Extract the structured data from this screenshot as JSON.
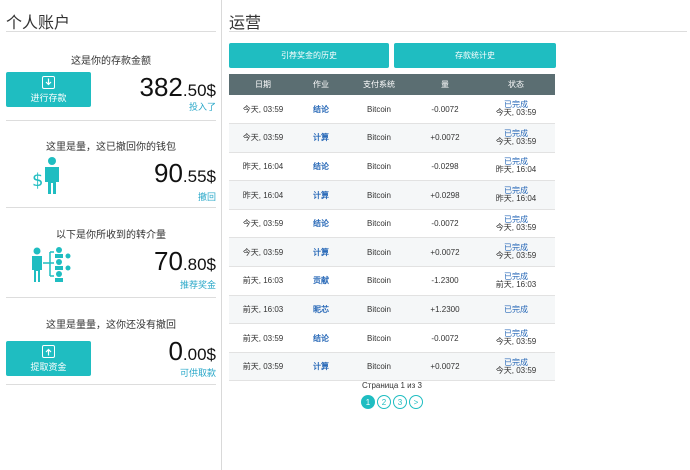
{
  "left": {
    "title": "个人账户",
    "blocks": [
      {
        "heading": "这是你的存款金额",
        "big": "382",
        "small": ".50$",
        "link": "投入了",
        "button": "进行存款"
      },
      {
        "heading": "这里是量，这已撤回你的钱包",
        "big": "90",
        "small": ".55$",
        "link": "撤回"
      },
      {
        "heading": "以下是你所收到的转介量",
        "big": "70",
        "small": ".80$",
        "link": "推荐奖金"
      },
      {
        "heading": "这里是量量，这你还没有撤回",
        "big": "0",
        "small": ".00$",
        "link": "可供取款",
        "button": "提取资金"
      }
    ]
  },
  "right": {
    "title": "运营",
    "tab1": "引荐奖金的历史",
    "tab2": "存款统计史",
    "columns": [
      "日期",
      "作业",
      "支付系统",
      "量",
      "状态"
    ],
    "rows": [
      {
        "date": "今天, 03:59",
        "op": "结论",
        "system": "Bitcoin",
        "amount": "-0.0072",
        "sign": "neg",
        "status": "已完成",
        "status_sub": "今天, 03:59"
      },
      {
        "date": "今天, 03:59",
        "op": "计算",
        "system": "Bitcoin",
        "amount": "+0.0072",
        "sign": "pos",
        "status": "已完成",
        "status_sub": "今天, 03:59"
      },
      {
        "date": "昨天, 16:04",
        "op": "结论",
        "system": "Bitcoin",
        "amount": "-0.0298",
        "sign": "neg",
        "status": "已完成",
        "status_sub": "昨天, 16:04"
      },
      {
        "date": "昨天, 16:04",
        "op": "计算",
        "system": "Bitcoin",
        "amount": "+0.0298",
        "sign": "pos",
        "status": "已完成",
        "status_sub": "昨天, 16:04"
      },
      {
        "date": "今天, 03:59",
        "op": "结论",
        "system": "Bitcoin",
        "amount": "-0.0072",
        "sign": "neg",
        "status": "已完成",
        "status_sub": "今天, 03:59"
      },
      {
        "date": "今天, 03:59",
        "op": "计算",
        "system": "Bitcoin",
        "amount": "+0.0072",
        "sign": "pos",
        "status": "已完成",
        "status_sub": "今天, 03:59"
      },
      {
        "date": "前天, 16:03",
        "op": "贡献",
        "system": "Bitcoin",
        "amount": "-1.2300",
        "sign": "neg",
        "status": "已完成",
        "status_sub": "前天, 16:03"
      },
      {
        "date": "前天, 16:03",
        "op": "昵芯",
        "system": "Bitcoin",
        "amount": "+1.2300",
        "sign": "pos",
        "status": "已完成",
        "status_sub": ""
      },
      {
        "date": "前天, 03:59",
        "op": "结论",
        "system": "Bitcoin",
        "amount": "-0.0072",
        "sign": "neg",
        "status": "已完成",
        "status_sub": "今天, 03:59"
      },
      {
        "date": "前天, 03:59",
        "op": "计算",
        "system": "Bitcoin",
        "amount": "+0.0072",
        "sign": "pos",
        "status": "已完成",
        "status_sub": "今天, 03:59"
      }
    ],
    "pager_text": "Страница 1 из 3",
    "pages": [
      "1",
      "2",
      "3",
      ">"
    ]
  }
}
